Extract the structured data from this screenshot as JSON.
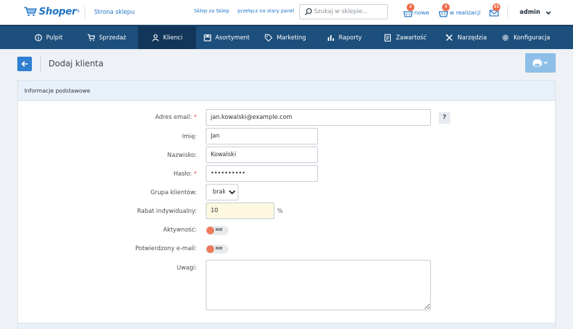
{
  "topbar": {
    "logo_text": "Shoper",
    "logo_reg": "®",
    "store_link": "Strona sklepu",
    "link_shop_for_shop": "Sklep za Sklep",
    "link_old_panel": "przełącz na stary panel",
    "search_placeholder": "Szukaj w sklepie...",
    "orders_new_count": "2",
    "orders_new_label": "nowe",
    "orders_in_progress_count": "3",
    "orders_in_progress_label": "w realizacji",
    "messages_count": "21",
    "user_name": "admin"
  },
  "nav": {
    "items": [
      {
        "label": "Pulpit",
        "icon": "info-circle-icon"
      },
      {
        "label": "Sprzedaż",
        "icon": "cart-icon"
      },
      {
        "label": "Klienci",
        "icon": "user-icon"
      },
      {
        "label": "Asortyment",
        "icon": "box-icon"
      },
      {
        "label": "Marketing",
        "icon": "tag-icon"
      },
      {
        "label": "Raporty",
        "icon": "bar-chart-icon"
      },
      {
        "label": "Zawartość",
        "icon": "document-icon"
      },
      {
        "label": "Narzędzia",
        "icon": "tools-icon"
      },
      {
        "label": "Konfiguracja",
        "icon": "gear-icon"
      }
    ],
    "active_index": 2
  },
  "page": {
    "title": "Dodaj klienta"
  },
  "form": {
    "section_title": "Informacje podstawowe",
    "email_label": "Adres email:",
    "email_value": "jan.kowalski@example.com",
    "help_label": "?",
    "firstname_label": "Imię:",
    "firstname_value": "Jan",
    "lastname_label": "Nazwisko:",
    "lastname_value": "Kowalski",
    "password_label": "Hasło:",
    "password_value": "password12",
    "group_label": "Grupa klientów:",
    "group_value": "brak",
    "discount_label": "Rabat indywidualny:",
    "discount_value": "10",
    "discount_unit": "%",
    "active_label": "Aktywność:",
    "active_toggle": "NIE",
    "verified_label": "Potwierdzony e-mail:",
    "verified_toggle": "NIE",
    "notes_label": "Uwagi:",
    "required_mark": "*"
  },
  "colors": {
    "brand_blue": "#1f73c4",
    "nav_bg": "#1d4f7c",
    "nav_active": "#12355a",
    "badge": "#ef6c4a",
    "toggle_off": "#ef7a5a"
  }
}
